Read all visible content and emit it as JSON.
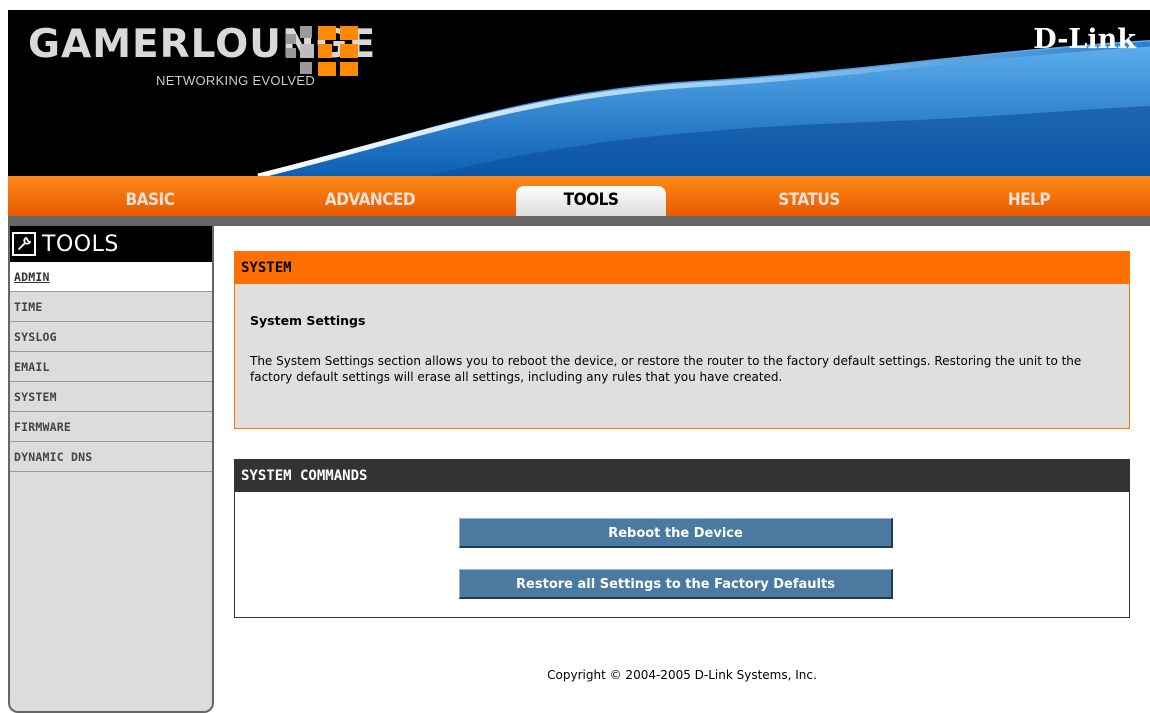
{
  "header": {
    "logo_text": "GAMERLOUNGE",
    "logo_tagline": "NETWORKING EVOLVED",
    "brand": "D-Link"
  },
  "tabs": [
    {
      "label": "BASIC",
      "active": false
    },
    {
      "label": "ADVANCED",
      "active": false
    },
    {
      "label": "TOOLS",
      "active": true
    },
    {
      "label": "STATUS",
      "active": false
    },
    {
      "label": "HELP",
      "active": false
    }
  ],
  "sidebar": {
    "title": "TOOLS",
    "icon": "wrench-icon",
    "items": [
      {
        "label": "ADMIN",
        "active": true
      },
      {
        "label": "TIME",
        "active": false
      },
      {
        "label": "SYSLOG",
        "active": false
      },
      {
        "label": "EMAIL",
        "active": false
      },
      {
        "label": "SYSTEM",
        "active": false
      },
      {
        "label": "FIRMWARE",
        "active": false
      },
      {
        "label": "DYNAMIC DNS",
        "active": false
      }
    ]
  },
  "system_panel": {
    "title": "SYSTEM",
    "subtitle": "System Settings",
    "description": "The System Settings section allows you to reboot the device, or restore the router to the factory default settings. Restoring the unit to the factory default settings will erase all settings, including any rules that you have created."
  },
  "commands_panel": {
    "title": "SYSTEM COMMANDS",
    "reboot_label": "Reboot the Device",
    "restore_label": "Restore all Settings to the Factory Defaults"
  },
  "footer": {
    "copyright": "Copyright © 2004-2005 D-Link Systems, Inc."
  },
  "colors": {
    "accent_orange": "#ff6f00",
    "button_blue": "#4a7aa0",
    "dark_bar": "#333333"
  }
}
